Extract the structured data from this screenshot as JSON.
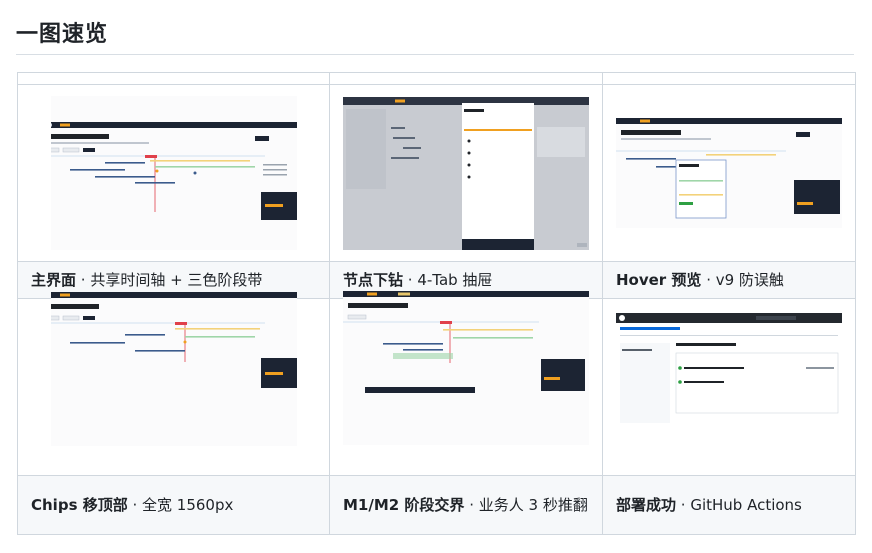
{
  "page": {
    "title": "一图速览"
  },
  "cells": [
    {
      "caption_bold": "主界面",
      "caption_rest": " · 共享时间轴 + 三色阶段带"
    },
    {
      "caption_bold": "节点下钻",
      "caption_rest": " · 4-Tab 抽屉"
    },
    {
      "caption_bold": "Hover 预览",
      "caption_rest": " · v9 防误触"
    },
    {
      "caption_bold": "Chips 移顶部",
      "caption_rest": " · 全宽 1560px"
    },
    {
      "caption_bold": "M1/M2 阶段交界",
      "caption_rest": " · 业务人 3 秒推翻"
    },
    {
      "caption_bold": "部署成功",
      "caption_rest": " · GitHub Actions"
    }
  ],
  "thumb_text": {
    "plan_title": "2026 Q2–Q3 合规路线 · 关键节点",
    "brand": "GANTT.CORE",
    "drawer_title": "冠军测试",
    "repo_name": "gantt-core",
    "deploy_label": "Deploy to GitHub Pages"
  },
  "colors": {
    "nav_dark": "#1c2433",
    "accent_orange": "#f0a020",
    "bar_blue": "#3b5b8c",
    "bar_green": "#9fd6a8",
    "bar_yellow": "#f3d27a",
    "today_red": "#e0404a",
    "gh_dark": "#24292f"
  }
}
